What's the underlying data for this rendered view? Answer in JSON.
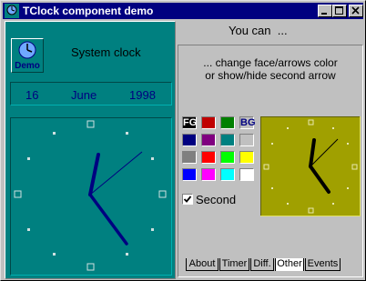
{
  "window": {
    "title": "TClock component demo"
  },
  "left_panel": {
    "demo_label": "Demo",
    "heading": "System clock",
    "date": {
      "day": "16",
      "month": "June",
      "year": "1998"
    }
  },
  "right_panel": {
    "header": "You can  ...",
    "subtitle_line1": "... change face/arrows color",
    "subtitle_line2": "or show/hide second arrow",
    "fg_label": "FG",
    "bg_label": "BG",
    "checkbox_label": "Second",
    "checkbox_checked": true,
    "swatches": [
      [
        "#c00000",
        "#008000",
        "#ffffff"
      ],
      [
        "#000080",
        "#800080",
        "#008080",
        "#c0c0c0"
      ],
      [
        "#808080",
        "#ff0000",
        "#00ff00",
        "#ffff00"
      ],
      [
        "#0000ff",
        "#ff00ff",
        "#00ffff",
        "#ffffff"
      ]
    ]
  },
  "tabs": [
    "About",
    "Timer",
    "Diff.",
    "Other",
    "Events"
  ],
  "active_tab": "Other",
  "colors": {
    "teal": "#008080",
    "olive": "#a0a000",
    "navy": "#000080",
    "titlebar": "#000080"
  }
}
